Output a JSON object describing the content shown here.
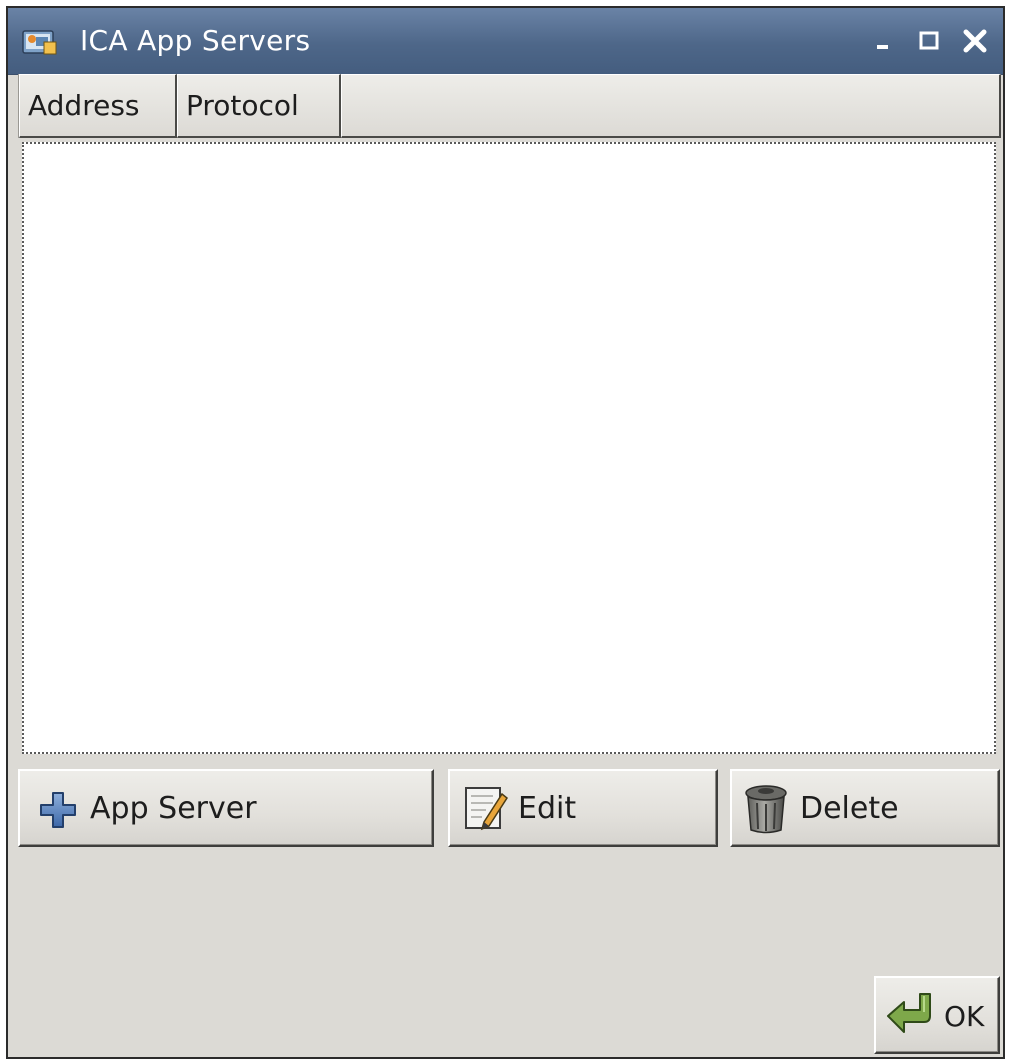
{
  "window": {
    "title": "ICA App Servers",
    "title_icon": "ica-app-icon",
    "controls": {
      "minimize_icon": "minimize-icon",
      "maximize_icon": "maximize-icon",
      "close_icon": "close-icon"
    }
  },
  "list": {
    "columns": [
      {
        "label": "Address"
      },
      {
        "label": "Protocol"
      }
    ],
    "rows": []
  },
  "actions": {
    "add_label": "App Server",
    "add_icon": "plus-icon",
    "edit_label": "Edit",
    "edit_icon": "edit-pencil-icon",
    "delete_label": "Delete",
    "delete_icon": "trash-can-icon"
  },
  "footer": {
    "ok_label": "OK",
    "ok_icon": "return-arrow-icon"
  },
  "colors": {
    "titlebar": "#4e6789",
    "window_bg": "#dcdad5",
    "list_bg": "#ffffff",
    "title_text": "#ffffff"
  }
}
